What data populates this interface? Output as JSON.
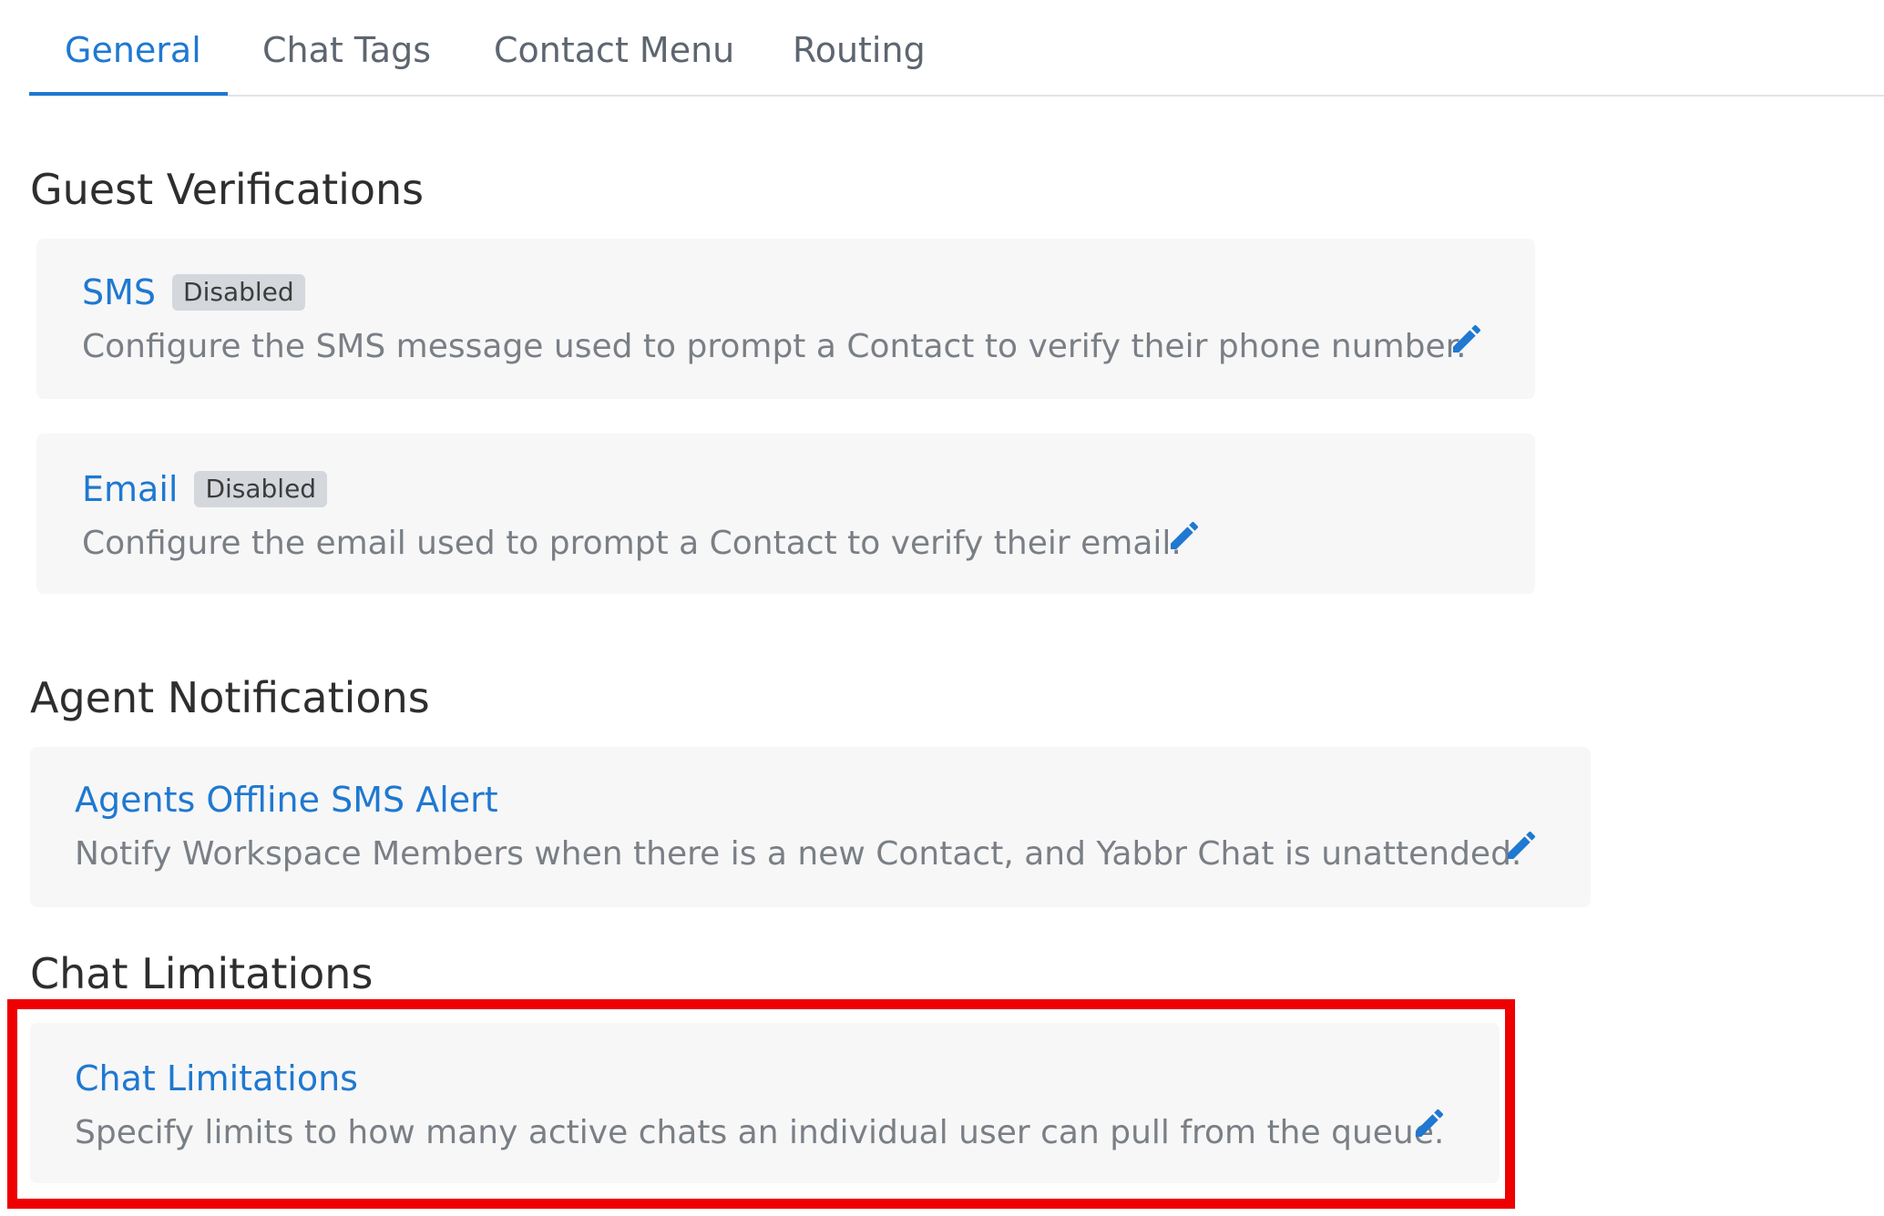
{
  "tabs": [
    {
      "label": "General",
      "active": true
    },
    {
      "label": "Chat Tags",
      "active": false
    },
    {
      "label": "Contact Menu",
      "active": false
    },
    {
      "label": "Routing",
      "active": false
    }
  ],
  "sections": {
    "guest_verifications": {
      "heading": "Guest Verifications",
      "cards": [
        {
          "title": "SMS",
          "badge": "Disabled",
          "description": "Configure the SMS message used to prompt a Contact to verify their phone number.",
          "icon": "pencil-icon"
        },
        {
          "title": "Email",
          "badge": "Disabled",
          "description": "Configure the email used to prompt a Contact to verify their email.",
          "icon": "pencil-icon"
        }
      ]
    },
    "agent_notifications": {
      "heading": "Agent Notifications",
      "cards": [
        {
          "title": "Agents Offline SMS Alert",
          "description": "Notify Workspace Members when there is a new Contact, and Yabbr Chat is unattended.",
          "icon": "pencil-icon"
        }
      ]
    },
    "chat_limitations": {
      "heading": "Chat Limitations",
      "cards": [
        {
          "title": "Chat Limitations",
          "description": "Specify limits to how many active chats an individual user can pull from the queue.",
          "icon": "pencil-icon"
        }
      ]
    }
  },
  "colors": {
    "accent": "#1f78d1",
    "card_background": "#f7f7f7",
    "badge_background": "#d4d7dc",
    "highlight": "#ee0000"
  }
}
